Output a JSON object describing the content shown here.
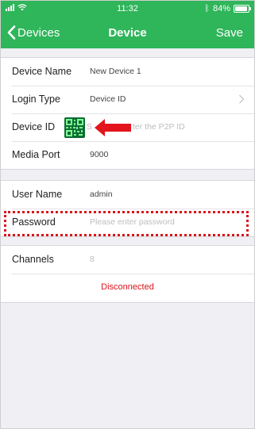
{
  "status_bar": {
    "time": "11:32",
    "battery_percent": "84%",
    "bluetooth_symbol": "∗"
  },
  "nav": {
    "back_label": "Devices",
    "title": "Device",
    "save_label": "Save"
  },
  "device_section": {
    "device_name": {
      "label": "Device Name",
      "value": "New Device 1"
    },
    "login_type": {
      "label": "Login Type",
      "value": "Device ID"
    },
    "device_id": {
      "label": "Device ID",
      "placeholder": "Scan or enter the P2P ID",
      "visible_tail": "ter the P2P ID",
      "visible_head": "S"
    },
    "media_port": {
      "label": "Media Port",
      "value": "9000"
    }
  },
  "user_section": {
    "user_name": {
      "label": "User Name",
      "value": "admin"
    },
    "password": {
      "label": "Password",
      "placeholder": "Please enter password"
    }
  },
  "channel_section": {
    "channels": {
      "label": "Channels",
      "value": "8"
    },
    "status": "Disconnected"
  },
  "colors": {
    "header": "#2fb55a",
    "accent_red": "#d8141b",
    "background": "#efeff4"
  },
  "icons": {
    "back": "chevron-left-icon",
    "login_type_disclosure": "chevron-right-icon",
    "scan": "qr-code-icon",
    "annotation": "red-arrow-icon"
  }
}
